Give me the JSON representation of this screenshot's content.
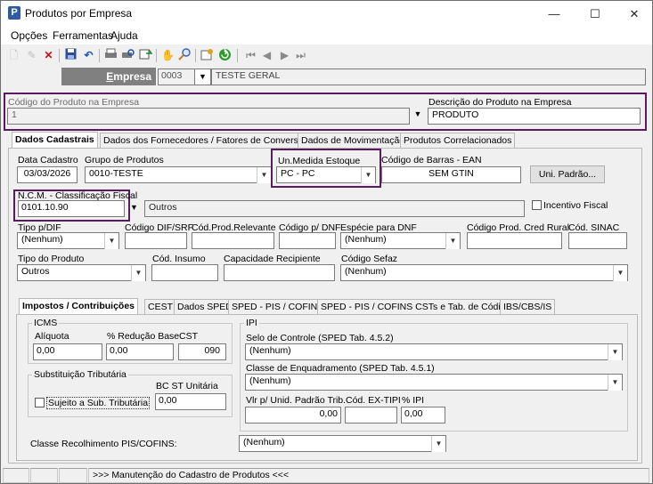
{
  "window": {
    "title": "Produtos por Empresa",
    "min": "—",
    "max": "☐",
    "close": "✕"
  },
  "menu": [
    "Opções",
    "Ferramentas",
    "Ajuda"
  ],
  "toolbar": [
    "new-icon",
    "edit-icon",
    "delete-icon",
    "save-icon",
    "undo-icon",
    "print-icon",
    "print-preview-icon",
    "export-icon",
    "hand-icon",
    "find-icon",
    "config-icon",
    "refresh-icon",
    "first-icon",
    "prev-icon",
    "next-icon",
    "last-icon"
  ],
  "empresa": {
    "label_pre": "",
    "label_u": "E",
    "label_rest": "mpresa",
    "code": "0003",
    "name": "TESTE GERAL"
  },
  "codigo": {
    "label": "Código do Produto na Empresa",
    "value": "1"
  },
  "descricao": {
    "label": "Descrição do Produto na Empresa",
    "value": "PRODUTO"
  },
  "tabs": [
    "Dados Cadastrais",
    "Dados dos Fornecedores / Fatores de Conversão",
    "Dados de Movimentação",
    "Produtos Correlacionados"
  ],
  "cad": {
    "data_label": "Data Cadastro",
    "data_value": "03/03/2026",
    "grupo_label": "Grupo de Produtos",
    "grupo_value": "0010-TESTE",
    "un_label": "Un.Medida Estoque",
    "un_value": "PC - PC",
    "ean_label": "Código de Barras - EAN",
    "ean_value": "SEM GTIN",
    "uni_btn": "Uni. Padrão...",
    "ncm_label": "N.C.M. - Classificação Fiscal",
    "ncm_value": "0101.10.90",
    "ncm_desc": "Outros",
    "incentivo": "Incentivo Fiscal",
    "tipo_dif_label": "Tipo p/DIF",
    "tipo_dif_value": "(Nenhum)",
    "cod_dif_label": "Código DIF/SRF",
    "cod_rel_label": "Cód.Prod.Relevante",
    "cod_dnf_label": "Código p/ DNF",
    "esp_dnf_label": "Espécie para DNF",
    "esp_dnf_value": "(Nenhum)",
    "cred_label": "Código Prod. Cred Rural",
    "sinac_label": "Cód. SINAC",
    "tipo_prod_label": "Tipo do Produto",
    "tipo_prod_value": "Outros",
    "insumo_label": "Cód. Insumo",
    "cap_label": "Capacidade Recipiente",
    "sefaz_label": "Código Sefaz",
    "sefaz_value": "(Nenhum)"
  },
  "subtabs": [
    "Impostos / Contribuições",
    "CEST",
    "Dados SPED",
    "SPED - PIS / COFINS",
    "SPED - PIS / COFINS CSTs e Tab. de Códigos",
    "IBS/CBS/IS"
  ],
  "icms": {
    "title": "ICMS",
    "aliquota_label": "Alíquota",
    "aliquota_value": "0,00",
    "reducao_label": "% Redução Base",
    "reducao_value": "0,00",
    "cst_label": "CST",
    "cst_value": "090"
  },
  "st": {
    "title": "Substituição Tributária",
    "bc_label": "BC ST Unitária",
    "bc_value": "0,00",
    "sujeito": "Sujeito a Sub. Tributária"
  },
  "ipi": {
    "title": "IPI",
    "selo_label": "Selo de Controle (SPED Tab. 4.5.2)",
    "selo_value": "(Nenhum)",
    "classe_label": "Classe de Enquadramento (SPED Tab. 4.5.1)",
    "classe_value": "(Nenhum)",
    "vlr_label": "Vlr p/ Unid. Padrão Trib.",
    "vlr_value": "0,00",
    "extipi_label": "Cód. EX-TIPI",
    "pct_label": "% IPI",
    "pct_value": "0,00"
  },
  "pis": {
    "label": "Classe Recolhimento PIS/COFINS:",
    "value": "(Nenhum)"
  },
  "status": {
    "message": ">>> Manutenção do Cadastro de Produtos <<<"
  }
}
